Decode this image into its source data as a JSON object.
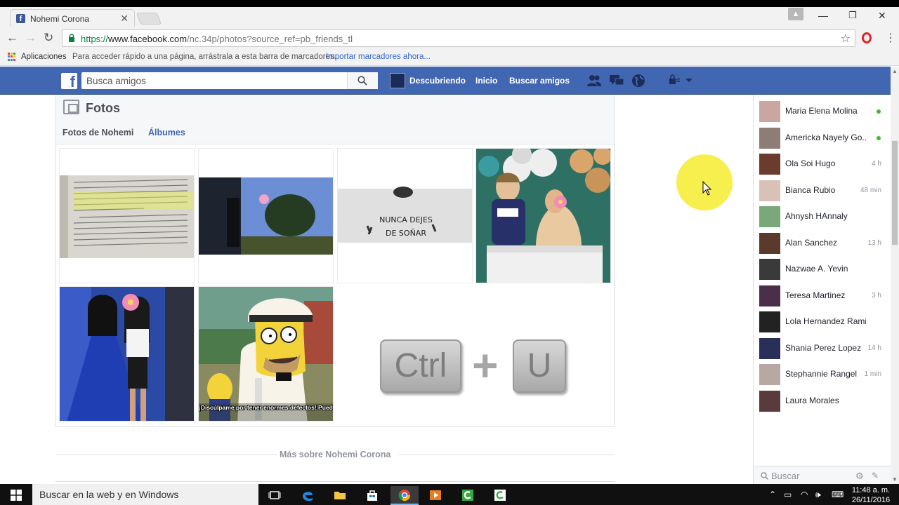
{
  "browser": {
    "tab_title": "Nohemi Corona",
    "tab_close": "✕",
    "url_scheme": "https://",
    "url_host": "www.facebook.com",
    "url_path": "/nc.34p/photos?source_ref=pb_friends_tl",
    "bookmarks": {
      "apps_label": "Aplicaciones",
      "hint": "Para acceder rápido a una página, arrástrala a esta barra de marcadores.",
      "import_link": "Importar marcadores ahora..."
    }
  },
  "facebook": {
    "search_placeholder": "Busca amigos",
    "nav": {
      "profile_link": "Descubriendo",
      "home_link": "Inicio",
      "find_friends_link": "Buscar amigos"
    },
    "colors": {
      "brand": "#4267b2",
      "online": "#42b72a"
    }
  },
  "photos": {
    "title": "Fotos",
    "tabs": [
      "Fotos de Nohemi",
      "Álbumes"
    ],
    "image_texts": {
      "dream": "NUNCA DEJES DE SOÑAR",
      "caption": "¡Discúlpame por tener enormes defectos! Puedo corregir!"
    },
    "shortcut_keys": [
      "Ctrl",
      "+",
      "U"
    ]
  },
  "more_about": "Más sobre Nohemi Corona",
  "chat": {
    "contacts": [
      {
        "name": "Maria Elena Molina",
        "status": "online",
        "time": ""
      },
      {
        "name": "Americka Nayely Go...",
        "status": "online",
        "time": ""
      },
      {
        "name": "Ola Soi Hugo",
        "status": "idle",
        "time": "4 h"
      },
      {
        "name": "Bianca Rubio",
        "status": "idle",
        "time": "48 min"
      },
      {
        "name": "Ahnysh HAnnaly",
        "status": "offline",
        "time": ""
      },
      {
        "name": "Alan Sanchez",
        "status": "idle",
        "time": "13 h"
      },
      {
        "name": "Nazwae A. Yevin",
        "status": "offline",
        "time": ""
      },
      {
        "name": "Teresa Martinez",
        "status": "idle",
        "time": "3 h"
      },
      {
        "name": "Lola Hernandez Ramirez",
        "status": "offline",
        "time": ""
      },
      {
        "name": "Shania Perez Lopez",
        "status": "idle",
        "time": "14 h"
      },
      {
        "name": "Stephannie Rangel",
        "status": "idle",
        "time": "1 min"
      },
      {
        "name": "Laura Morales",
        "status": "offline",
        "time": ""
      }
    ],
    "search_placeholder": "Buscar"
  },
  "taskbar": {
    "search_placeholder": "Buscar en la web y en Windows",
    "time": "11:48 a. m.",
    "date": "26/11/2016"
  }
}
